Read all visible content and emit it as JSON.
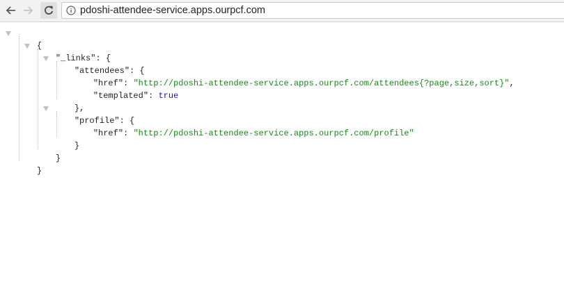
{
  "browser": {
    "back_icon": "arrow-left-icon",
    "forward_icon": "arrow-right-icon",
    "reload_icon": "reload-icon",
    "site_info_icon": "info-circle-icon",
    "url": "pdoshi-attendee-service.apps.ourpcf.com"
  },
  "json_view": {
    "open_root": "{",
    "links_key": "\"_links\"",
    "colon_brace": ": {",
    "attendees_key": "\"attendees\"",
    "href_key": "\"href\"",
    "colon": ": ",
    "attendees_href": "\"http://pdoshi-attendee-service.apps.ourpcf.com/attendees{?page,size,sort}\"",
    "comma": ",",
    "templated_key": "\"templated\"",
    "templated_value": "true",
    "close_attendees": "},",
    "profile_key": "\"profile\"",
    "profile_href": "\"http://pdoshi-attendee-service.apps.ourpcf.com/profile\"",
    "close_profile": "}",
    "close_links": "}",
    "close_root": "}"
  },
  "colors": {
    "string": "#1a8a1a",
    "keyword": "#1a1aa6",
    "toolbar": "#f2f2f2"
  }
}
